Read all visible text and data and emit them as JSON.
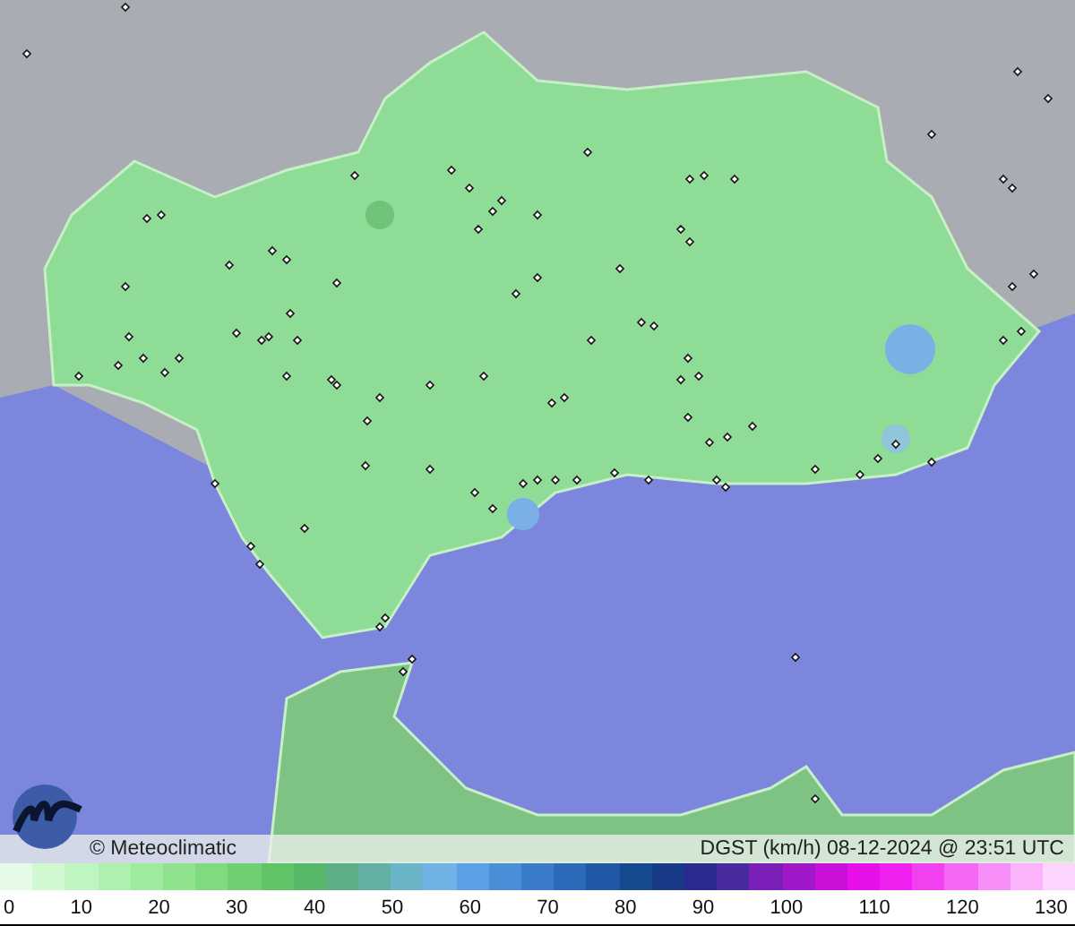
{
  "credit": "© Meteoclimatic",
  "caption": "DGST (km/h)  08-12-2024 @ 23:51 UTC",
  "scale_labels": [
    "0",
    "10",
    "20",
    "30",
    "40",
    "50",
    "60",
    "70",
    "80",
    "90",
    "100",
    "110",
    "120",
    "130"
  ]
}
